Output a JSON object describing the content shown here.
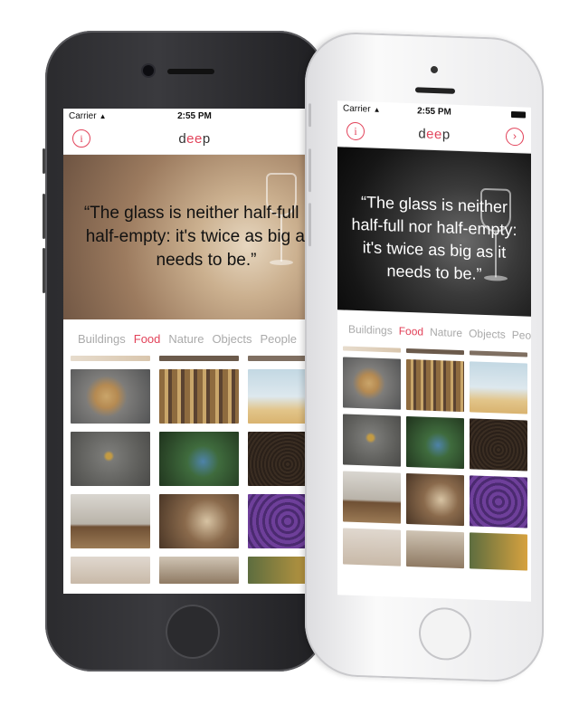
{
  "app": {
    "status": {
      "carrier": "Carrier",
      "time": "2:55 PM"
    },
    "logo": {
      "first": "d",
      "accent": "ee",
      "last": "p"
    },
    "info_icon": "info-icon",
    "next_icon": "chevron-right-circle-icon",
    "quote": "“The glass is neither half-full nor half-empty: it's twice as big as it needs to be.”",
    "categories": [
      {
        "label": "Buildings",
        "active": false
      },
      {
        "label": "Food",
        "active": true
      },
      {
        "label": "Nature",
        "active": false
      },
      {
        "label": "Objects",
        "active": false
      },
      {
        "label": "People",
        "active": false
      }
    ],
    "photos": [
      "top-strip",
      "top-strip",
      "top-strip",
      "pears-on-plate",
      "grocery-shelf",
      "jar-of-juice",
      "marble-with-coin",
      "blueberries",
      "coffee-beans",
      "espresso-glass",
      "wine-glass",
      "purple-grapes",
      "cafe-table",
      "restaurant-window",
      "mango"
    ],
    "accent_color": "#e2435a"
  }
}
